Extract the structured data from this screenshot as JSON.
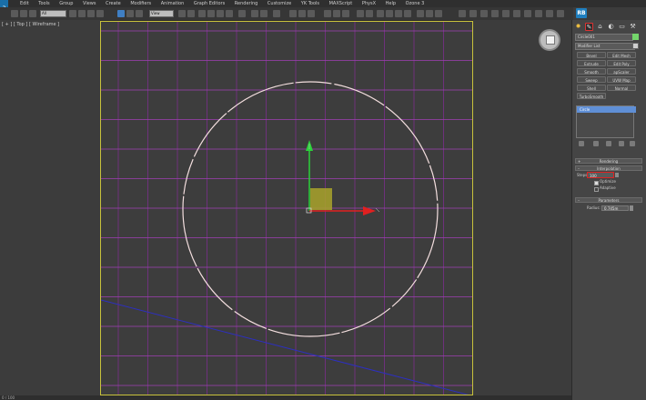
{
  "app": {
    "logo_text": "3"
  },
  "menu": {
    "items": [
      "Edit",
      "Tools",
      "Group",
      "Views",
      "Create",
      "Modifiers",
      "Animation",
      "Graph Editors",
      "Rendering",
      "Customize",
      "YK Tools",
      "MAXScript",
      "PhysX",
      "Help",
      "Ozone 3"
    ]
  },
  "toolbar": {
    "selection_filter": "All",
    "reference_coord": "View",
    "rb_badge": "RB"
  },
  "viewport": {
    "label": "[ + ] [ Top ] [ Wireframe ]",
    "colors": {
      "grid": "#7b2f8c",
      "grid_major": "#a13fb5",
      "border": "#c8c23c",
      "circle": "#f3dede",
      "axis_y": "#2bd23a",
      "axis_x": "#e12020",
      "gizmo": "#a9a32a",
      "horizon": "#2d2fc0"
    }
  },
  "status": {
    "text": "0 / 100"
  },
  "command_panel": {
    "object_name": "Circle001",
    "object_color": "#74d66b",
    "modifier_list_label": "Modifier List",
    "modifier_buttons": [
      [
        "Bevel",
        "Edit Mesh"
      ],
      [
        "Extrude",
        "Edit Poly"
      ],
      [
        "Smooth",
        "apScaler (WSM"
      ],
      [
        "Sweep",
        "UVW Map"
      ],
      [
        "Shell",
        "Normal"
      ],
      [
        "TurboSmooth",
        ""
      ]
    ],
    "stack_selected": "Circle",
    "rollouts": {
      "rendering": "Rendering",
      "interpolation": "Interpolation",
      "parameters": "Parameters"
    },
    "interpolation": {
      "steps_label": "Steps:",
      "steps_value": "100",
      "optimize_label": "Optimize",
      "adaptive_label": "Adaptive"
    },
    "parameters": {
      "radius_label": "Radius:",
      "radius_value": "0.745m"
    }
  }
}
